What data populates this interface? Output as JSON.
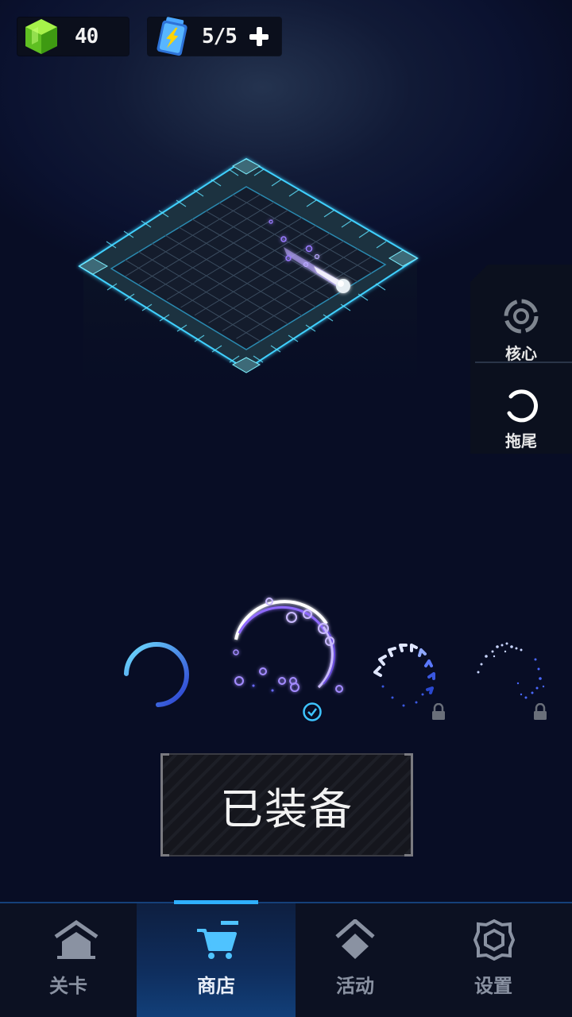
{
  "resources": {
    "gems": "40",
    "energy": "5/5"
  },
  "side_menu": {
    "core_label": "核心",
    "tail_label": "拖尾"
  },
  "carousel": {
    "selected_index": 2,
    "items": [
      {
        "name": "cyan-arc",
        "locked": false,
        "equipped": false
      },
      {
        "name": "bubble-ring",
        "locked": false,
        "equipped": true
      },
      {
        "name": "chevron-ring",
        "locked": true,
        "equipped": false
      },
      {
        "name": "spark-ring",
        "locked": true,
        "equipped": false
      }
    ]
  },
  "equip_button": {
    "label": "已装备"
  },
  "nav": {
    "active": "shop",
    "tabs": [
      {
        "id": "levels",
        "label": "关卡"
      },
      {
        "id": "shop",
        "label": "商店"
      },
      {
        "id": "events",
        "label": "活动"
      },
      {
        "id": "settings",
        "label": "设置"
      }
    ]
  },
  "colors": {
    "accent": "#2fb0ff",
    "gem": "#6bd12c",
    "grid_glow": "#3fd0ff",
    "trail_purple": "#9a7bff"
  }
}
